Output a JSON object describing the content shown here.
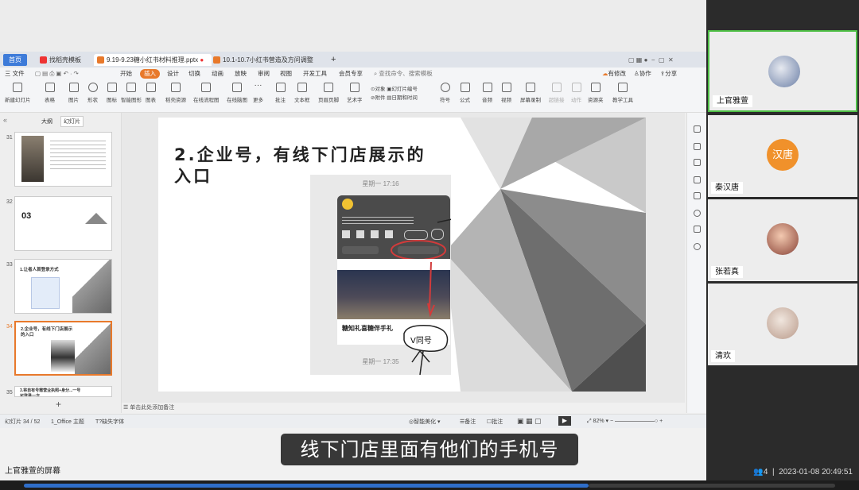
{
  "tabs": {
    "home": "首页",
    "tab1": "找稻壳模板",
    "tab2": "9.19-9.23糖小红书材料推理.pptx",
    "tab3": "10.1-10.7小红书营造及方问调整",
    "add": "+"
  },
  "menu": {
    "file": "三 文件",
    "items": [
      "开始",
      "插入",
      "设计",
      "切换",
      "动画",
      "放映",
      "审阅",
      "视图",
      "开发工具",
      "会员专享"
    ],
    "search": "查找命令、搜索模板",
    "right": [
      "有修改",
      "协作",
      "分享"
    ]
  },
  "ribbon": [
    "新建幻灯片",
    "表格",
    "图片",
    "形状",
    "图标",
    "智能图形",
    "图表",
    "稻壳资源",
    "在线流程图",
    "在线脑图",
    "更多",
    "批注",
    "文本框",
    "页眉页脚",
    "艺术字",
    "附件",
    "对象",
    "幻灯片编号",
    "日期和时间",
    "符号",
    "公式",
    "音频",
    "视频",
    "屏幕录制",
    "超链接",
    "动作",
    "资源夹",
    "教学工具"
  ],
  "left_pane": {
    "tab_outline": "大纲",
    "tab_slides": "幻灯片",
    "thumbs": [
      {
        "num": "31",
        "text": ""
      },
      {
        "num": "32",
        "text": "03"
      },
      {
        "num": "33",
        "text": "1.让者人首登录方式"
      },
      {
        "num": "34",
        "text": "2.企业号，有线下门店展示的入口"
      },
      {
        "num": "35",
        "text": "3.将自有号需营业执照+身分...一号可登录一次"
      }
    ],
    "add": "+"
  },
  "slide": {
    "title_line1": "2.企业号，有线下门店展示的",
    "title_line2": "入口",
    "phone_time_top": "星期一 17:16",
    "phone_time_bottom": "星期一 17:35",
    "phone_caption": "糖知礼喜糖伴手礼",
    "annotation": "V同号"
  },
  "notes": {
    "text": "单击此处添加备注"
  },
  "status": {
    "slide_info": "幻灯片 34 / 52",
    "theme": "1_Office 主题",
    "font": "缺失字体",
    "beautify": "智能美化",
    "notes": "备注",
    "comments": "批注",
    "zoom": "82%"
  },
  "subtitle": "线下门店里面有他们的手机号",
  "share_label": "上官雅萱的屏幕",
  "participants": [
    {
      "name": "上官雅萱",
      "avatar": "photo",
      "color": "#6b7fa6"
    },
    {
      "name": "秦汉唐",
      "avatar": "text",
      "avatar_text": "汉唐",
      "color": "#f0912b"
    },
    {
      "name": "张若真",
      "avatar": "photo",
      "color": "#a86a5a"
    },
    {
      "name": "清欢",
      "avatar": "photo",
      "color": "#b99a8a"
    }
  ],
  "meeting_info": {
    "count": "4",
    "timestamp": "2023-01-08 20:49:51"
  }
}
